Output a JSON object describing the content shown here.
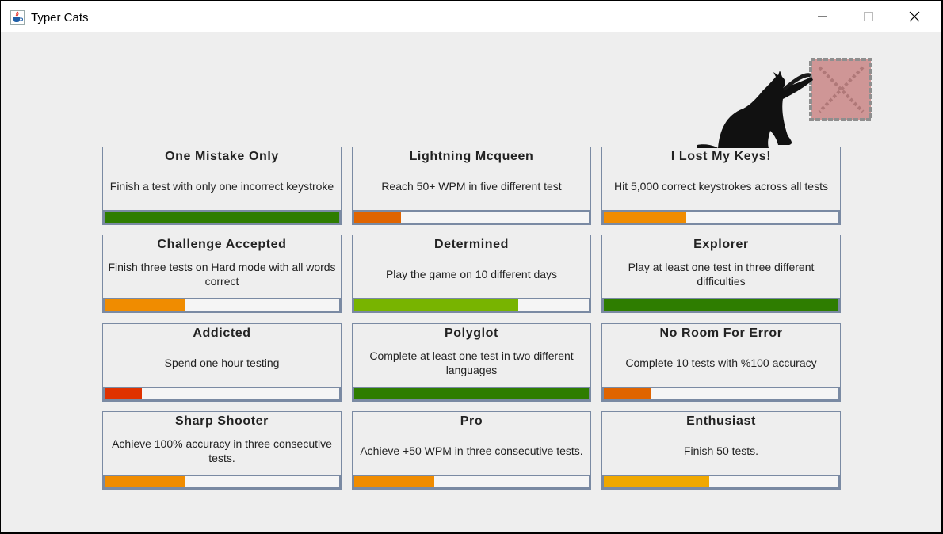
{
  "window": {
    "title": "Typer Cats",
    "app_icon": "java-cup-icon",
    "buttons": [
      "minimize-icon",
      "maximize-icon",
      "close-icon"
    ]
  },
  "achievements": [
    {
      "title": "One Mistake Only",
      "description": "Finish a test with only one incorrect keystroke",
      "progress": 1.0,
      "color": "#2e7d00"
    },
    {
      "title": "Lightning Mcqueen",
      "description": "Reach 50+ WPM in five different test",
      "progress": 0.2,
      "color": "#e06400"
    },
    {
      "title": "I Lost My Keys!",
      "description": "Hit 5,000 correct keystrokes across all tests",
      "progress": 0.35,
      "color": "#f08c00"
    },
    {
      "title": "Challenge Accepted",
      "description": "Finish three tests on Hard mode with all words correct",
      "progress": 0.34,
      "color": "#f08c00"
    },
    {
      "title": "Determined",
      "description": "Play the game on 10 different days",
      "progress": 0.7,
      "color": "#78b400"
    },
    {
      "title": "Explorer",
      "description": "Play at least one test in three different difficulties",
      "progress": 1.0,
      "color": "#2e7d00"
    },
    {
      "title": "Addicted",
      "description": "Spend one hour testing",
      "progress": 0.16,
      "color": "#e03200"
    },
    {
      "title": "Polyglot",
      "description": "Complete at least one test in two different languages",
      "progress": 1.0,
      "color": "#2e7d00"
    },
    {
      "title": "No Room For Error",
      "description": "Complete 10 tests with %100 accuracy",
      "progress": 0.2,
      "color": "#e06400"
    },
    {
      "title": "Sharp Shooter",
      "description": "Achieve 100% accuracy in three consecutive tests.",
      "progress": 0.34,
      "color": "#f08c00"
    },
    {
      "title": "Pro",
      "description": "Achieve +50 WPM in three consecutive tests.",
      "progress": 0.34,
      "color": "#f08c00"
    },
    {
      "title": "Enthusiast",
      "description": "Finish 50 tests.",
      "progress": 0.45,
      "color": "#f0a800"
    }
  ],
  "decoration": {
    "image": "black-cat-scratching-box-icon"
  }
}
